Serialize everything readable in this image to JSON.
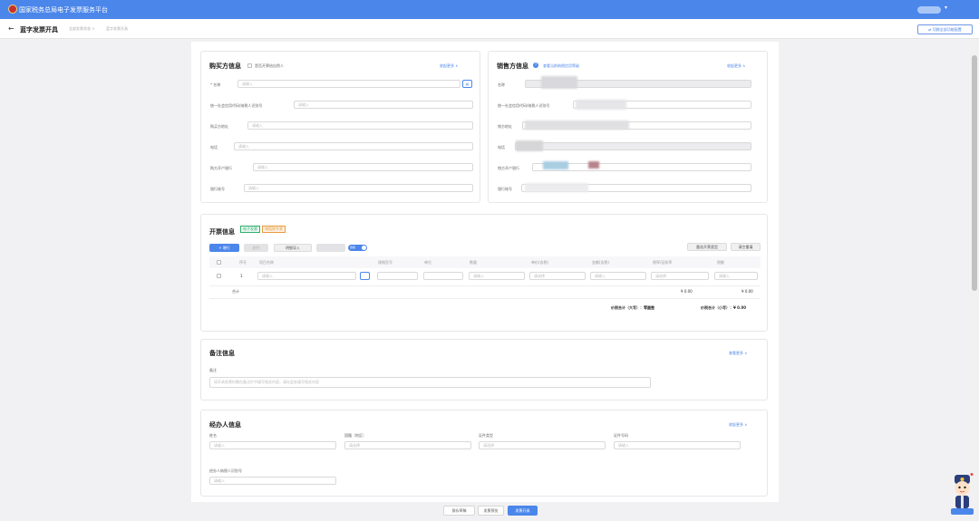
{
  "app": {
    "title": "国家税务总局电子发票服务平台"
  },
  "page": {
    "title": "蓝字发票开具",
    "crumb1": "全部发票状态",
    "crumb_sep": ">",
    "crumb2": "蓝字发票开具",
    "switch_label": "切换全部功能配置"
  },
  "buyer": {
    "title": "购买方信息",
    "natural_person_label": "是否开票给自然人",
    "expand": "收起更多 ∧",
    "fields": [
      {
        "label": "* 名称",
        "placeholder": "请输入"
      },
      {
        "label": "统一社会信用代码/纳税人识别号",
        "placeholder": "请输入"
      },
      {
        "label": "购买方地址",
        "placeholder": "请输入"
      },
      {
        "label": "电话",
        "placeholder": "请输入"
      },
      {
        "label": "购方开户银行",
        "placeholder": "请输入"
      },
      {
        "label": "银行账号",
        "placeholder": "请输入"
      }
    ]
  },
  "seller": {
    "title": "销售方信息",
    "link": "查看当前纳税信用等级",
    "expand": "收起更多 ∧",
    "fields": [
      {
        "label": "名称"
      },
      {
        "label": "统一社会信用代码/纳税人识别号"
      },
      {
        "label": "销方地址"
      },
      {
        "label": "电话"
      },
      {
        "label": "销方开户银行"
      },
      {
        "label": "银行账号"
      }
    ]
  },
  "invoice": {
    "title": "开票信息",
    "tag1": "电子发票",
    "tag2": "增值税专票",
    "add_row": "+ 增行",
    "delete_row": "删除",
    "quick_import": "明细导入",
    "toggle_label": "含税",
    "btn_reselect": "重选开票类型",
    "btn_clear": "清空重填",
    "columns": [
      "序号",
      "项目名称",
      "规格型号",
      "单位",
      "数量",
      "单价(含税)",
      "金额(含税)",
      "税率/征收率",
      "税额"
    ],
    "row_no": "1",
    "row_placeholder": "请输入",
    "tax_rate_placeholder": "请选择",
    "total_label": "合计",
    "total_amount": "¥ 0.00",
    "total_tax": "¥ 0.00",
    "sum_upper_label": "价税合计（大写）：",
    "sum_upper_value": "零圆整",
    "sum_lower_label": "价税合计（小写）：",
    "sum_lower_value": "¥ 0.00"
  },
  "remarks": {
    "title": "备注信息",
    "expand": "查看更多 ∨",
    "label": "备注",
    "placeholder": "如开具发票时需在备注栏中填写相关内容，请在此处填写相关内容"
  },
  "agent": {
    "title": "经办人信息",
    "expand": "收起更多 ∧",
    "name_label": "姓名",
    "name_placeholder": "请输入",
    "country_label": "国籍（地区）",
    "country_placeholder": "请选择",
    "idtype_label": "证件类型",
    "idtype_placeholder": "请选择",
    "idno_label": "证件号码",
    "idno_placeholder": "请输入",
    "taxid_label": "经办人纳税人识别号",
    "taxid_placeholder": "请输入"
  },
  "footer": {
    "save": "保存草稿",
    "preview": "发票预览",
    "issue": "发票开具"
  },
  "colors": {
    "primary": "#4b86ea",
    "topbar": "#4b86ea",
    "tag1": "#2fae6e",
    "tag2": "#e89a3c"
  }
}
